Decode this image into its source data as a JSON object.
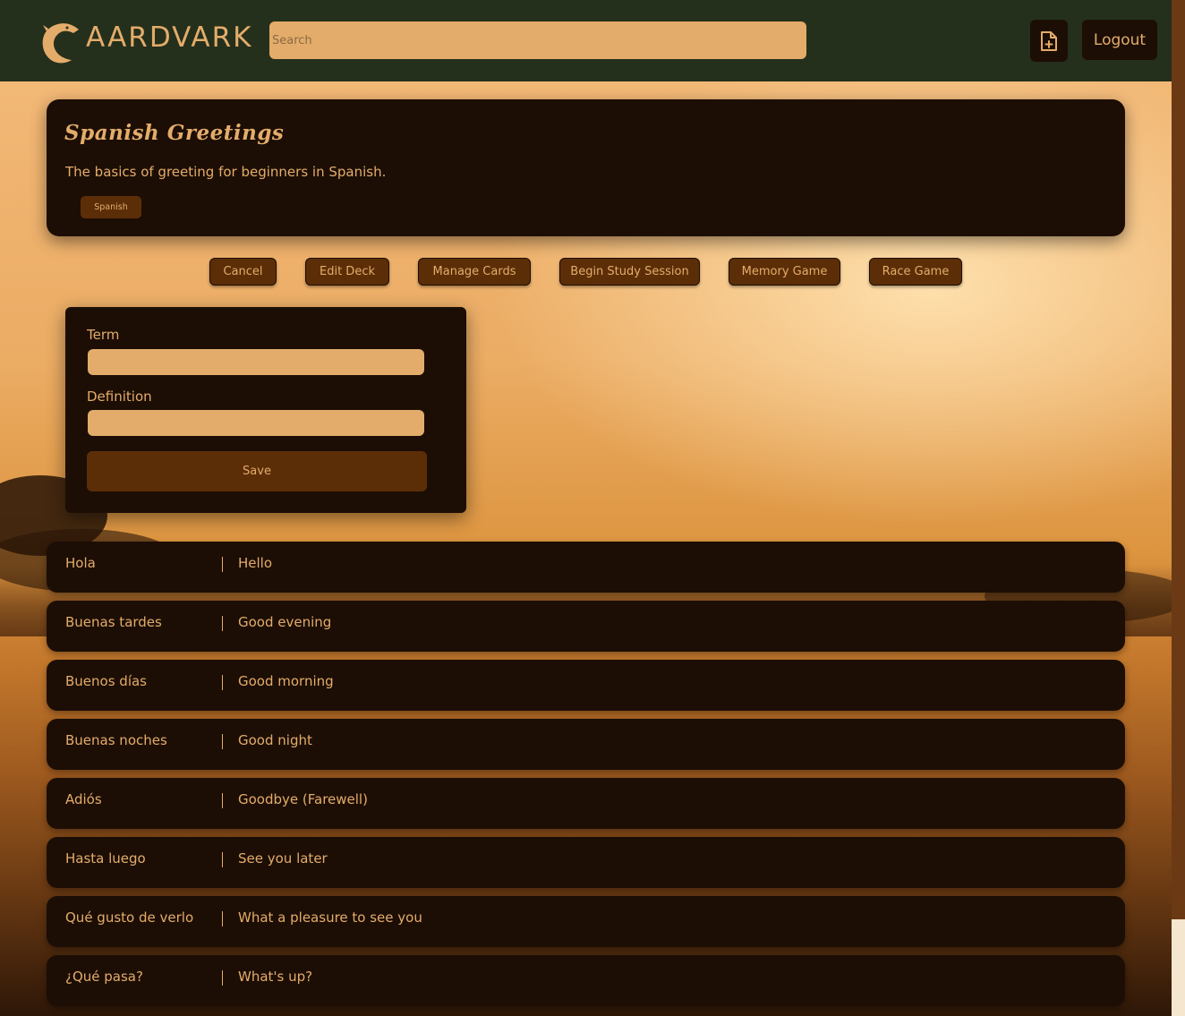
{
  "header": {
    "brand": "AARDVARK",
    "search_placeholder": "Search",
    "logout_label": "Logout"
  },
  "deck": {
    "title": "Spanish Greetings",
    "description": "The basics of greeting for beginners in Spanish.",
    "tag": "Spanish"
  },
  "actions": [
    "Cancel",
    "Edit Deck",
    "Manage Cards",
    "Begin Study Session",
    "Memory Game",
    "Race Game"
  ],
  "form": {
    "term_label": "Term",
    "definition_label": "Definition",
    "save_label": "Save"
  },
  "cards": [
    {
      "term": "Hola",
      "definition": "Hello"
    },
    {
      "term": "Buenas tardes",
      "definition": "Good evening"
    },
    {
      "term": "Buenos días",
      "definition": "Good morning"
    },
    {
      "term": "Buenas noches",
      "definition": "Good night"
    },
    {
      "term": "Adiós",
      "definition": "Goodbye (Farewell)"
    },
    {
      "term": "Hasta luego",
      "definition": "See you later"
    },
    {
      "term": "Qué gusto de verlo",
      "definition": "What a pleasure to see you"
    },
    {
      "term": "¿Qué pasa?",
      "definition": "What's up?"
    }
  ],
  "colors": {
    "header_bg": "#24301c",
    "accent": "#e4ac6a",
    "panel": "#1c0e05",
    "button": "#5c2e08"
  },
  "icons": {
    "logo": "aardvark-logo-icon",
    "new_deck": "file-plus-icon"
  }
}
